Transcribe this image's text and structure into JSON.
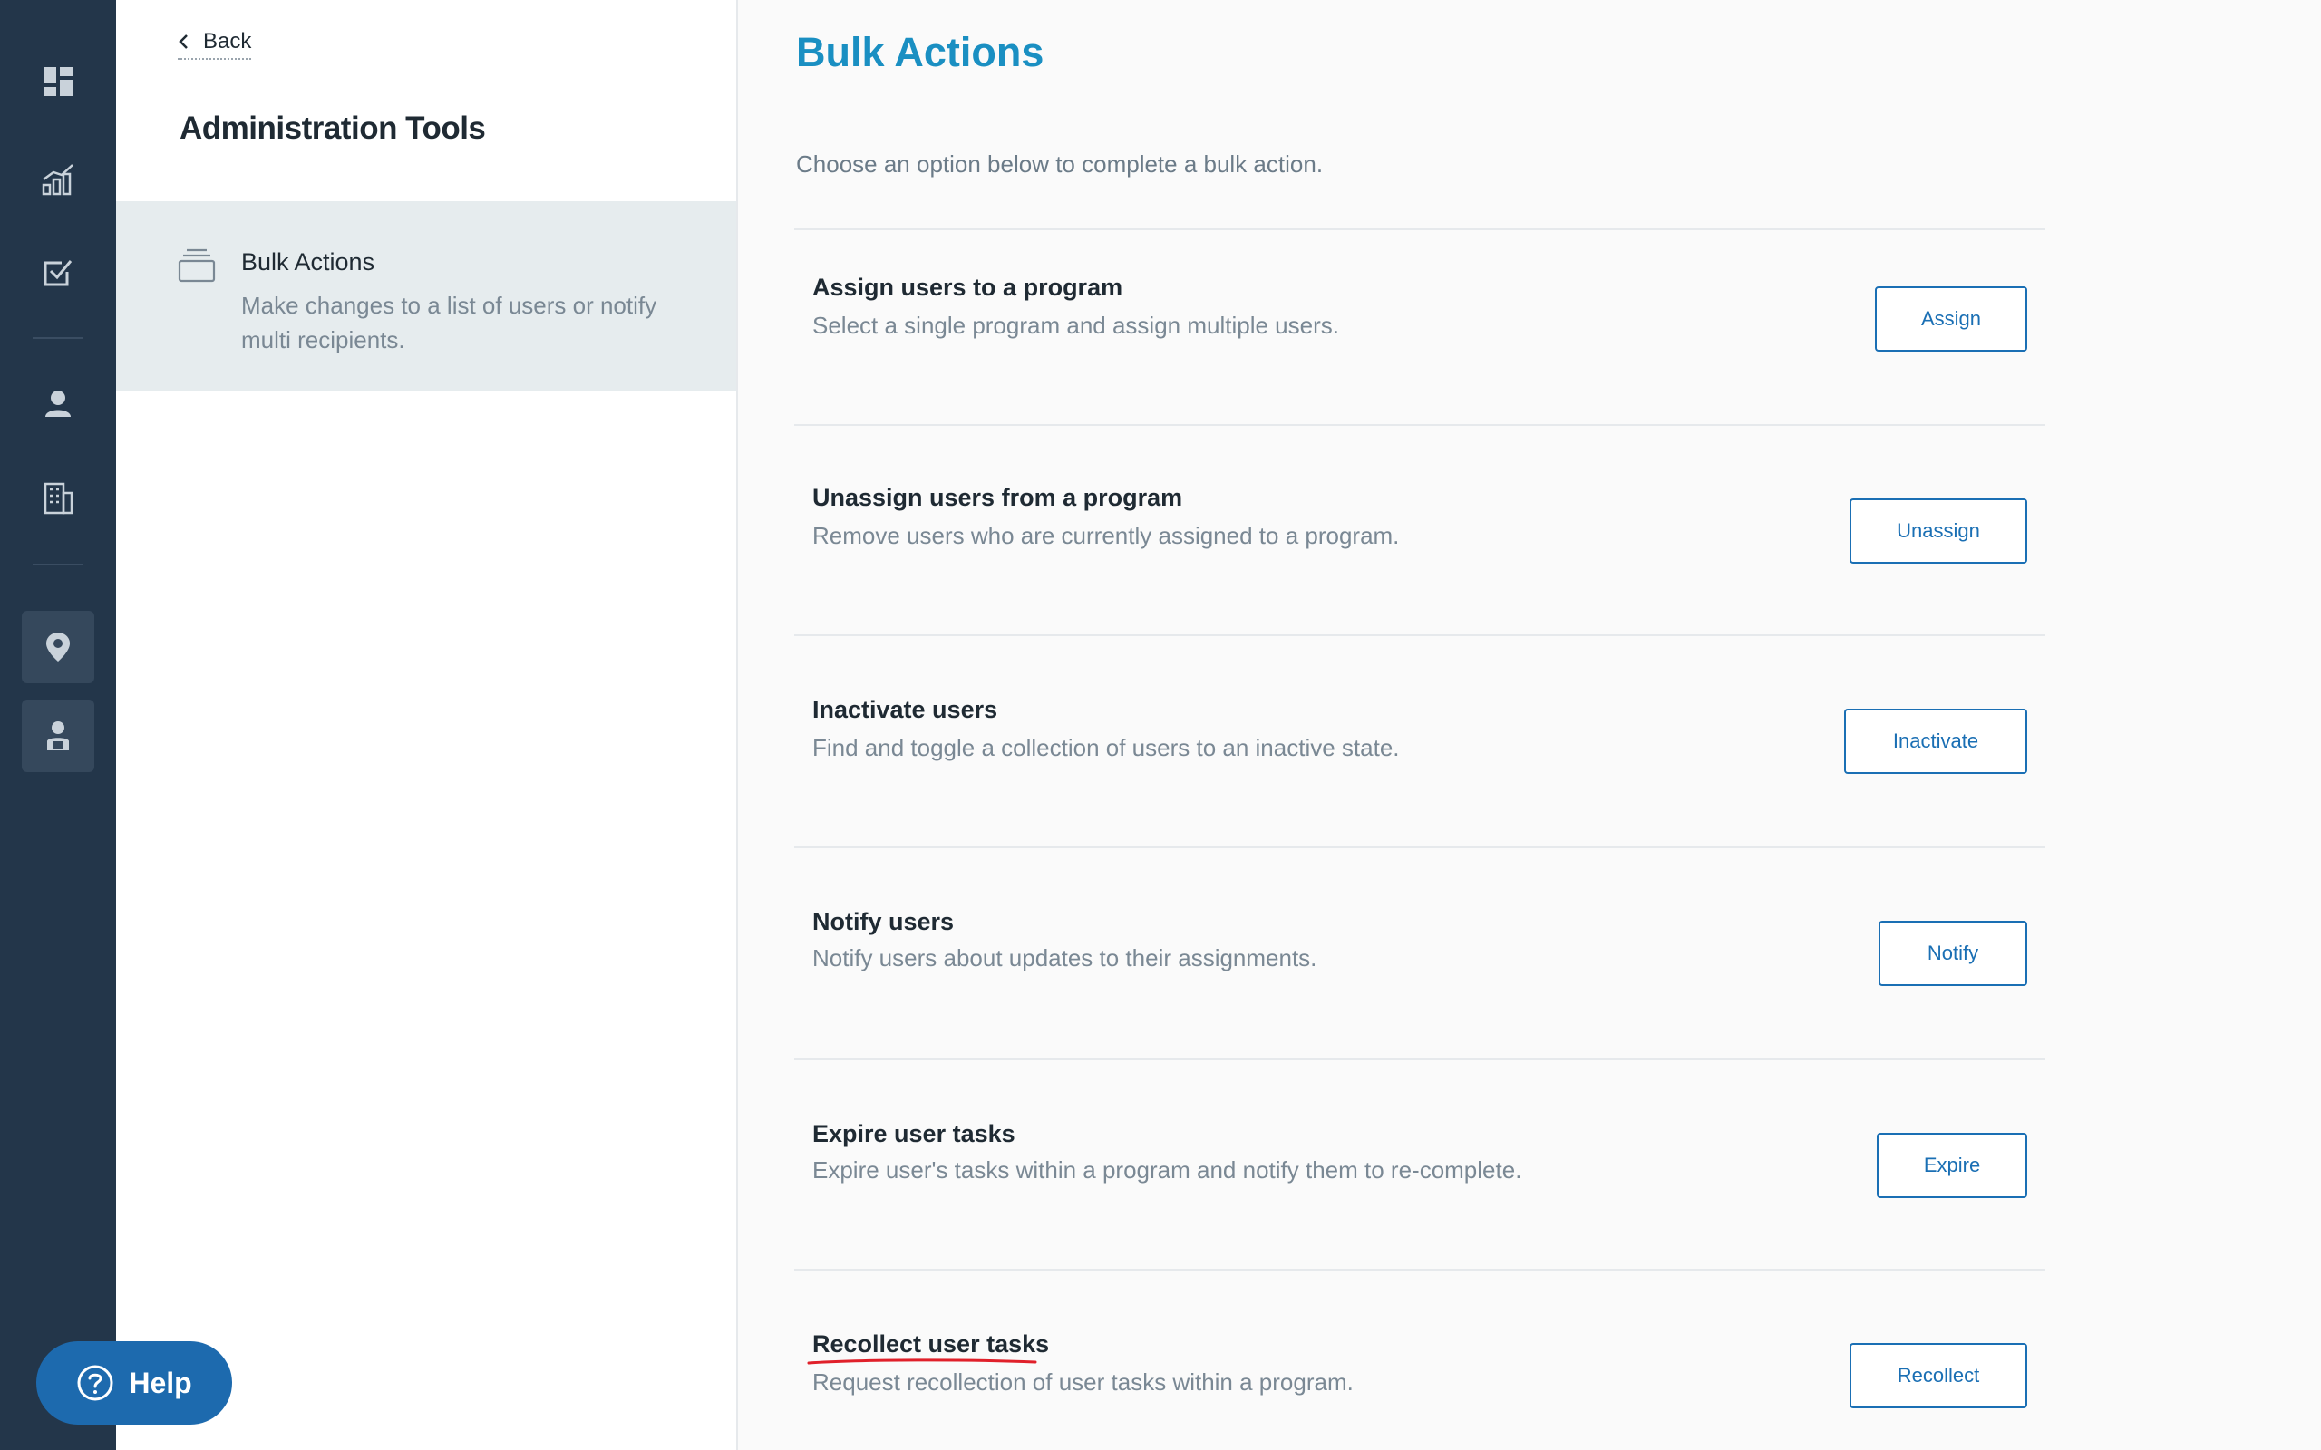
{
  "rail": {
    "icons": [
      "dashboard-icon",
      "analytics-icon",
      "tasks-icon",
      "user-icon",
      "building-icon",
      "location-icon",
      "admin-icon"
    ]
  },
  "panel": {
    "back_label": "Back",
    "title": "Administration Tools",
    "nav": [
      {
        "label": "Bulk Actions",
        "description": "Make changes to a list of users or notify multi recipients."
      }
    ]
  },
  "main": {
    "title": "Bulk Actions",
    "intro": "Choose an option below to complete a bulk action.",
    "actions": [
      {
        "title": "Assign users to a program",
        "description": "Select a single program and assign multiple users.",
        "button": "Assign"
      },
      {
        "title": "Unassign users from a program",
        "description": "Remove users who are currently assigned to a program.",
        "button": "Unassign"
      },
      {
        "title": "Inactivate users",
        "description": "Find and toggle a collection of users to an inactive state.",
        "button": "Inactivate"
      },
      {
        "title": "Notify users",
        "description": "Notify users about updates to their assignments.",
        "button": "Notify"
      },
      {
        "title": "Expire user tasks",
        "description": "Expire user's tasks within a program and notify them to re-complete.",
        "button": "Expire"
      },
      {
        "title": "Recollect user tasks",
        "description": "Request recollection of user tasks within a program.",
        "button": "Recollect"
      }
    ]
  },
  "help": {
    "label": "Help"
  },
  "colors": {
    "rail_bg": "#23364a",
    "accent_title": "#1a8fc2",
    "button_border": "#1a6fb4",
    "help_bg": "#1d6aae",
    "annotation_underline": "#e0202a"
  }
}
